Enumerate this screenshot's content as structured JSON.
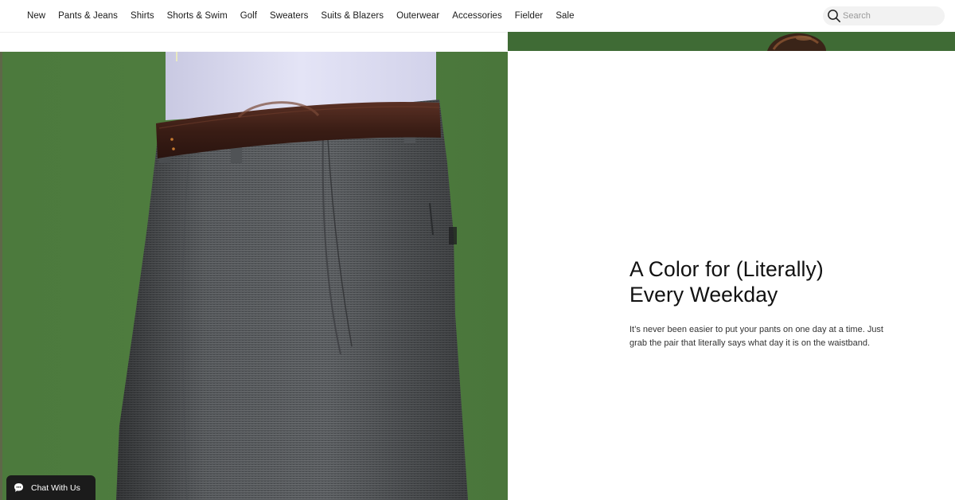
{
  "nav": {
    "items": [
      {
        "label": "New"
      },
      {
        "label": "Pants & Jeans"
      },
      {
        "label": "Shirts"
      },
      {
        "label": "Shorts & Swim"
      },
      {
        "label": "Golf"
      },
      {
        "label": "Sweaters"
      },
      {
        "label": "Suits & Blazers"
      },
      {
        "label": "Outerwear"
      },
      {
        "label": "Accessories"
      },
      {
        "label": "Fielder"
      },
      {
        "label": "Sale"
      }
    ]
  },
  "search": {
    "placeholder": "Search",
    "icon": "search-icon"
  },
  "feature": {
    "title_line1": "A Color for (Literally)",
    "title_line2": "Every Weekday",
    "body_line1": "It’s never been easier to put your pants on one day at a time. Just",
    "body_line2": "grab the pair that literally says what day it is on the waistband."
  },
  "chat": {
    "label": "Chat With Us",
    "icon": "chat-bubble-icon"
  },
  "colors": {
    "background_green": "#4f7a3f",
    "pants_gray": "#55585b",
    "belt_brown": "#3b1f16",
    "shirt_lavender": "#dcdcf2",
    "chat_button": "#1b1b1b"
  }
}
